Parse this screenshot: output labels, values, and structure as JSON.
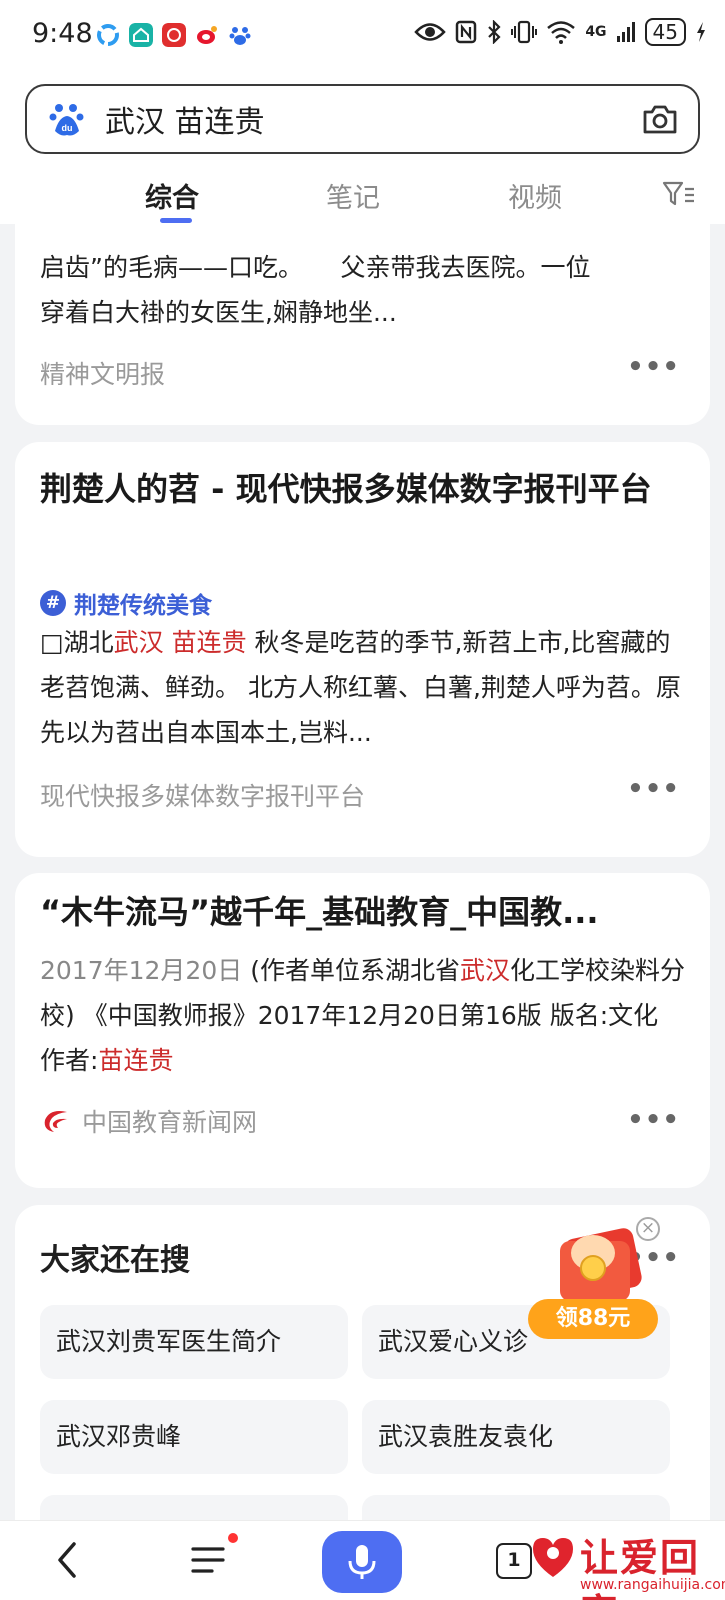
{
  "status": {
    "time": "9:48",
    "battery": "45",
    "network": "4G"
  },
  "search": {
    "query": "武汉 苗连贵"
  },
  "tabs": [
    {
      "label": "综合",
      "active": true
    },
    {
      "label": "笔记",
      "active": false
    },
    {
      "label": "视频",
      "active": false
    }
  ],
  "results": [
    {
      "snippet_line1": "启齿”的毛病——口吃。　　父亲带我去医院。一位",
      "snippet_line2": "穿着白大褂的女医生,娴静地坐...",
      "source": "精神文明报"
    },
    {
      "title": "荆楚人的苕 - 现代快报多媒体数字报刊平台",
      "topic": "荆楚传统美食",
      "snippet_pre": "□湖北",
      "snippet_hl": "武汉 苗连贵",
      "snippet_post": " 秋冬是吃苕的季节,新苕上市,比窖藏的老苕饱满、鲜劲。 北方人称红薯、白薯,荆楚人呼为苕。原先以为苕出自本国本土,岂料...",
      "source": "现代快报多媒体数字报刊平台"
    },
    {
      "title": "“木牛流马”越千年_基础教育_中国教...",
      "date": "2017年12月20日",
      "snippet_a": " (作者单位系湖北省",
      "snippet_hl1": "武汉",
      "snippet_b": "化工学校染料分校) 《中国教师报》2017年12月20日第16版 版名:文化 作者:",
      "snippet_hl2": "苗连贵",
      "source": "中国教育新闻网"
    }
  ],
  "related": {
    "title": "大家还在搜",
    "items": [
      "武汉刘贵军医生简介",
      "武汉爱心义诊",
      "武汉邓贵峰",
      "武汉袁胜友袁化"
    ]
  },
  "promo": {
    "label": "领88元"
  },
  "bottom": {
    "pages_count": "1"
  },
  "watermark": {
    "text": "让爱回家",
    "url": "www.rangaihuijia.com"
  },
  "colors": {
    "accent": "#4e6ef2",
    "highlight": "#cc2b2b",
    "promo": "#ffa31a"
  }
}
